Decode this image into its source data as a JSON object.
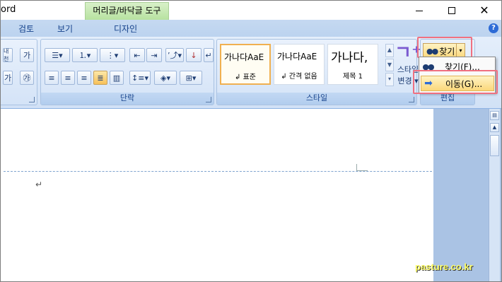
{
  "window": {
    "title": "ord"
  },
  "context_tab": {
    "title": "머리글/바닥글 도구"
  },
  "tabs": [
    {
      "label": "검토"
    },
    {
      "label": "보기"
    },
    {
      "label": "디자인"
    }
  ],
  "groups": {
    "paragraph": {
      "label": "단락"
    },
    "styles": {
      "label": "스타일"
    },
    "editing": {
      "label": "편집"
    }
  },
  "font_buttons": {
    "char_box": "가",
    "enclosed": "㉮"
  },
  "styles_gallery": [
    {
      "sample": "가나다AaE",
      "name": "↲ 표준"
    },
    {
      "sample": "가나다AaE",
      "name": "↲ 간격 없음"
    },
    {
      "sample": "가나다,",
      "name": "제목 1"
    }
  ],
  "change_styles": {
    "label_line1": "스타일",
    "label_line2": "변경 ▾",
    "icon": "ka-icon"
  },
  "editing": {
    "find_button_label": "찾기",
    "menu": [
      {
        "label": "찾기(F)...",
        "icon": "binoculars-icon"
      },
      {
        "label": "이동(G)...",
        "icon": "arrow-right-icon"
      }
    ]
  },
  "document": {
    "paragraph_mark": "↵"
  },
  "watermark": {
    "text": "pasture.co.kr"
  },
  "colors": {
    "accent": "#f07080",
    "highlight": "#fbd77a",
    "ribbon": "#d1e1f6"
  }
}
